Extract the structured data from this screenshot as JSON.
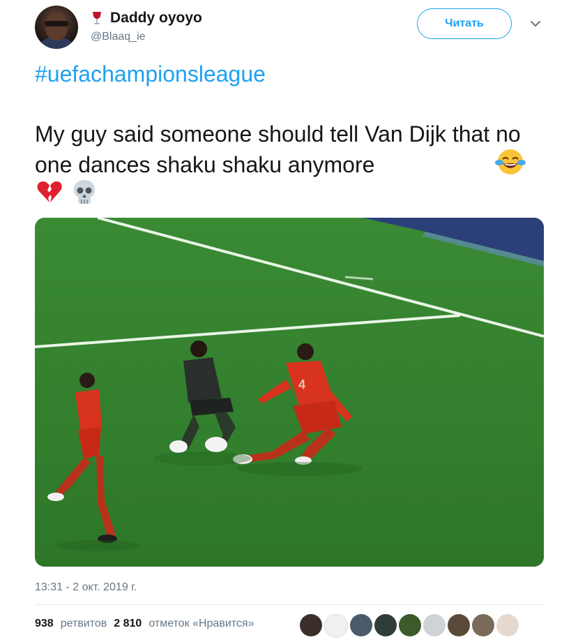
{
  "user": {
    "emoji_icon": "wine-glass-icon",
    "display_name": "Daddy oyoyo",
    "handle": "@Blaaq_ie"
  },
  "actions": {
    "follow_label": "Читать",
    "more_icon": "chevron-down-icon"
  },
  "tweet": {
    "hashtag": "#uefachampionsleague",
    "text": "My guy said someone should tell Van Dijk that no one dances shaku shaku anymore",
    "emojis": [
      "face-with-tears-of-joy-icon",
      "broken-heart-icon",
      "skull-icon"
    ]
  },
  "media": {
    "type": "image",
    "description_icon": "soccer-match-image"
  },
  "meta": {
    "timestamp": "13:31 - 2 окт. 2019 г."
  },
  "stats": {
    "retweets_count": "938",
    "retweets_label": "ретвитов",
    "likes_count": "2 810",
    "likes_label": "отметок «Нравится»"
  },
  "colors": {
    "accent": "#1da1f2",
    "text": "#14171a",
    "muted": "#657786"
  }
}
